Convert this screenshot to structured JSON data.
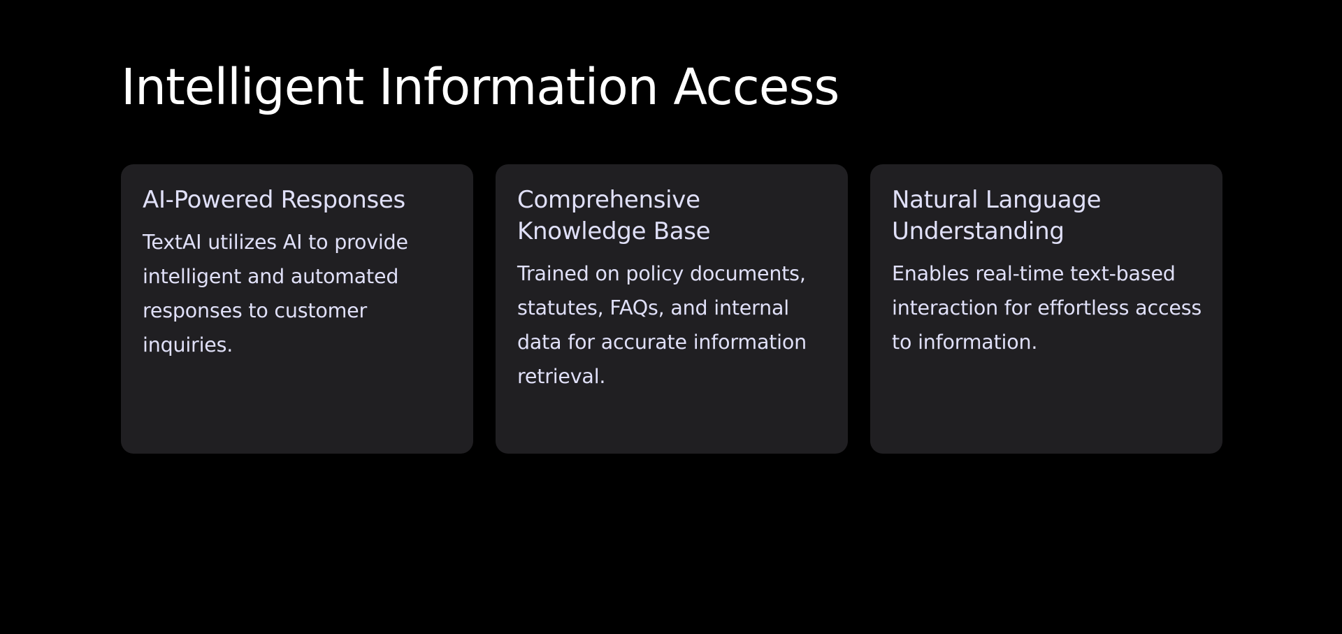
{
  "page": {
    "title": "Intelligent Information Access"
  },
  "colors": {
    "background": "#000000",
    "card_background": "#201f22",
    "title_text": "#ffffff",
    "card_text": "#e0e0f8"
  },
  "cards": [
    {
      "title": "AI-Powered Responses",
      "text": "TextAI utilizes AI to provide intelligent and automated responses to customer inquiries."
    },
    {
      "title": "Comprehensive Knowledge Base",
      "text": "Trained on policy documents, statutes, FAQs, and internal data for accurate information retrieval."
    },
    {
      "title": "Natural Language Understanding",
      "text": "Enables real-time text-based interaction for effortless access to information."
    }
  ]
}
